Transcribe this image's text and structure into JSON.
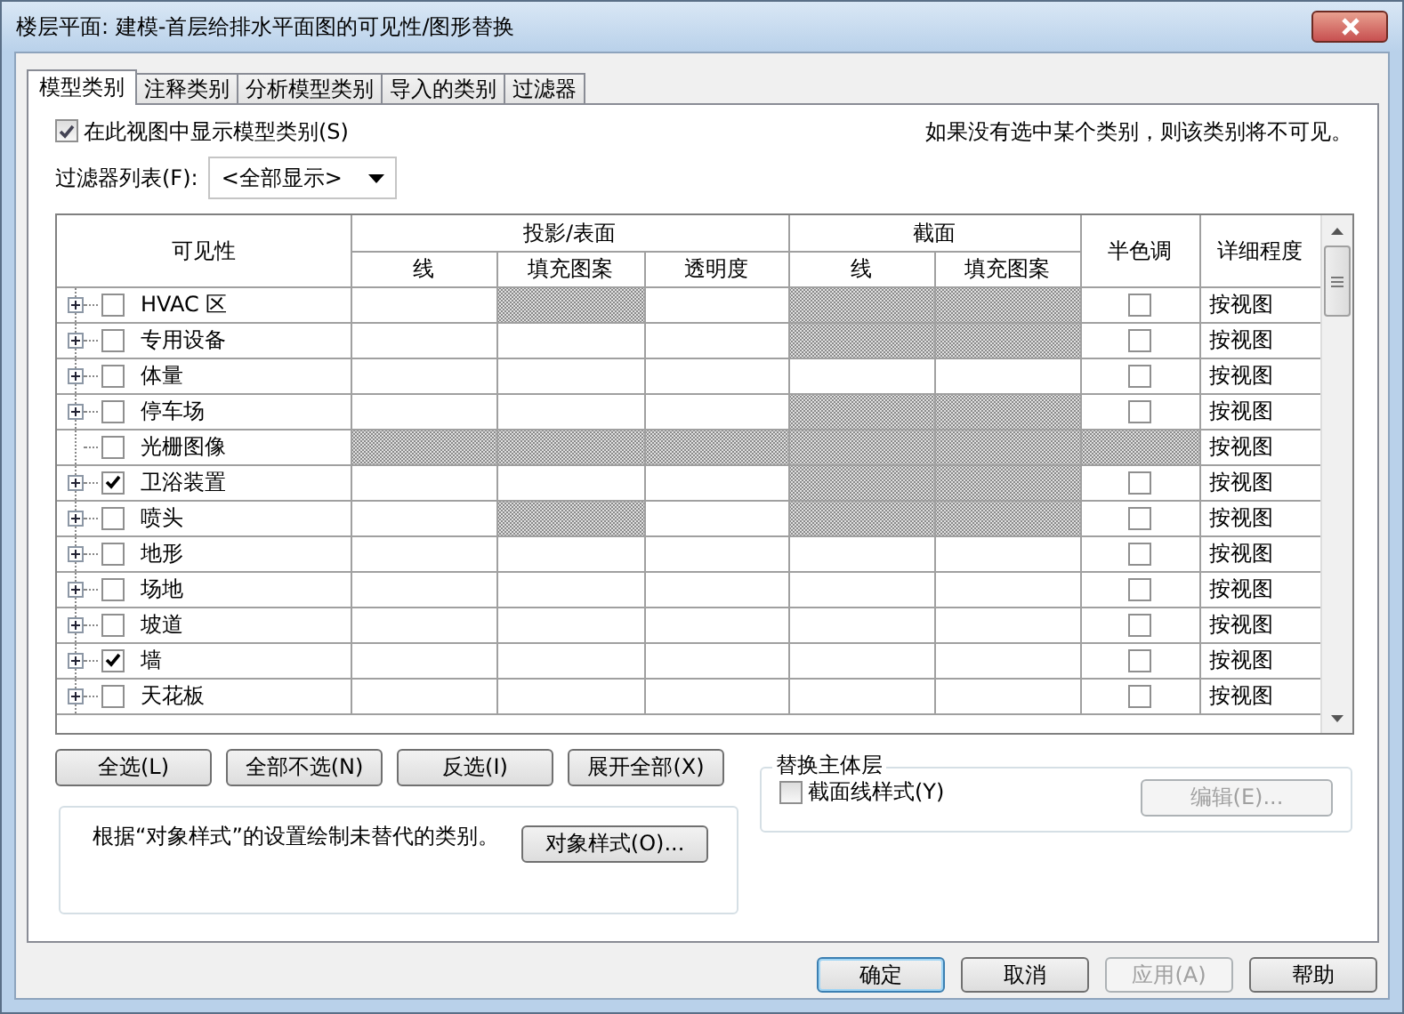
{
  "window": {
    "title": "楼层平面: 建模-首层给排水平面图的可见性/图形替换"
  },
  "tabs": [
    {
      "label": "模型类别",
      "selected": true
    },
    {
      "label": "注释类别",
      "selected": false
    },
    {
      "label": "分析模型类别",
      "selected": false
    },
    {
      "label": "导入的类别",
      "selected": false
    },
    {
      "label": "过滤器",
      "selected": false
    }
  ],
  "show_categories": {
    "label": "在此视图中显示模型类别(S)",
    "checked": true
  },
  "hint": "如果没有选中某个类别，则该类别将不可见。",
  "filter_list": {
    "label": "过滤器列表(F):",
    "value": "<全部显示>"
  },
  "table": {
    "columns": [
      {
        "label": "可见性"
      },
      {
        "label": "投影/表面",
        "children": [
          "线",
          "填充图案",
          "透明度"
        ]
      },
      {
        "label": "截面",
        "children": [
          "线",
          "填充图案"
        ]
      },
      {
        "label": "半色调"
      },
      {
        "label": "详细程度"
      }
    ],
    "rows": [
      {
        "name": "HVAC 区",
        "checked": false,
        "expandable": true,
        "overrides": [
          {
            "unavailable": false
          },
          {
            "unavailable": true
          },
          {
            "unavailable": false
          },
          {
            "unavailable": true
          },
          {
            "unavailable": true
          }
        ],
        "halftone": {
          "checked": false,
          "unavailable": false
        },
        "detail_level": "按视图"
      },
      {
        "name": "专用设备",
        "checked": false,
        "expandable": true,
        "overrides": [
          {
            "unavailable": false
          },
          {
            "unavailable": false
          },
          {
            "unavailable": false
          },
          {
            "unavailable": true
          },
          {
            "unavailable": true
          }
        ],
        "halftone": {
          "checked": false,
          "unavailable": false
        },
        "detail_level": "按视图"
      },
      {
        "name": "体量",
        "checked": false,
        "expandable": true,
        "overrides": [
          {
            "unavailable": false
          },
          {
            "unavailable": false
          },
          {
            "unavailable": false
          },
          {
            "unavailable": false
          },
          {
            "unavailable": false
          }
        ],
        "halftone": {
          "checked": false,
          "unavailable": false
        },
        "detail_level": "按视图"
      },
      {
        "name": "停车场",
        "checked": false,
        "expandable": true,
        "overrides": [
          {
            "unavailable": false
          },
          {
            "unavailable": false
          },
          {
            "unavailable": false
          },
          {
            "unavailable": true
          },
          {
            "unavailable": true
          }
        ],
        "halftone": {
          "checked": false,
          "unavailable": false
        },
        "detail_level": "按视图"
      },
      {
        "name": "光栅图像",
        "checked": false,
        "expandable": false,
        "overrides": [
          {
            "unavailable": true
          },
          {
            "unavailable": true
          },
          {
            "unavailable": true
          },
          {
            "unavailable": true
          },
          {
            "unavailable": true
          }
        ],
        "halftone": {
          "unavailable": true
        },
        "detail_level": "按视图"
      },
      {
        "name": "卫浴装置",
        "checked": true,
        "expandable": true,
        "overrides": [
          {
            "unavailable": false
          },
          {
            "unavailable": false
          },
          {
            "unavailable": false
          },
          {
            "unavailable": true
          },
          {
            "unavailable": true
          }
        ],
        "halftone": {
          "checked": false,
          "unavailable": false
        },
        "detail_level": "按视图"
      },
      {
        "name": "喷头",
        "checked": false,
        "expandable": true,
        "overrides": [
          {
            "unavailable": false
          },
          {
            "unavailable": true
          },
          {
            "unavailable": false
          },
          {
            "unavailable": true
          },
          {
            "unavailable": true
          }
        ],
        "halftone": {
          "checked": false,
          "unavailable": false
        },
        "detail_level": "按视图"
      },
      {
        "name": "地形",
        "checked": false,
        "expandable": true,
        "overrides": [
          {
            "unavailable": false
          },
          {
            "unavailable": false
          },
          {
            "unavailable": false
          },
          {
            "unavailable": false
          },
          {
            "unavailable": false
          }
        ],
        "halftone": {
          "checked": false,
          "unavailable": false
        },
        "detail_level": "按视图"
      },
      {
        "name": "场地",
        "checked": false,
        "expandable": true,
        "overrides": [
          {
            "unavailable": false
          },
          {
            "unavailable": false
          },
          {
            "unavailable": false
          },
          {
            "unavailable": false
          },
          {
            "unavailable": false
          }
        ],
        "halftone": {
          "checked": false,
          "unavailable": false
        },
        "detail_level": "按视图"
      },
      {
        "name": "坡道",
        "checked": false,
        "expandable": true,
        "overrides": [
          {
            "unavailable": false
          },
          {
            "unavailable": false
          },
          {
            "unavailable": false
          },
          {
            "unavailable": false
          },
          {
            "unavailable": false
          }
        ],
        "halftone": {
          "checked": false,
          "unavailable": false
        },
        "detail_level": "按视图"
      },
      {
        "name": "墙",
        "checked": true,
        "expandable": true,
        "overrides": [
          {
            "unavailable": false
          },
          {
            "unavailable": false
          },
          {
            "unavailable": false
          },
          {
            "unavailable": false
          },
          {
            "unavailable": false
          }
        ],
        "halftone": {
          "checked": false,
          "unavailable": false
        },
        "detail_level": "按视图"
      },
      {
        "name": "天花板",
        "checked": false,
        "expandable": true,
        "overrides": [
          {
            "unavailable": false
          },
          {
            "unavailable": false
          },
          {
            "unavailable": false
          },
          {
            "unavailable": false
          },
          {
            "unavailable": false
          }
        ],
        "halftone": {
          "checked": false,
          "unavailable": false
        },
        "detail_level": "按视图"
      }
    ]
  },
  "selection_buttons": [
    "全选(L)",
    "全部不选(N)",
    "反选(I)",
    "展开全部(X)"
  ],
  "object_styles": {
    "text": "根据“对象样式”的设置绘制未替代的类别。",
    "button": "对象样式(O)..."
  },
  "host_layers": {
    "title": "替换主体层",
    "checkbox": {
      "label": "截面线样式(Y)",
      "checked": false
    },
    "edit_button": {
      "label": "编辑(E)...",
      "disabled": true
    }
  },
  "dialog_buttons": [
    {
      "label": "确定",
      "default": true,
      "disabled": false
    },
    {
      "label": "取消",
      "default": false,
      "disabled": false
    },
    {
      "label": "应用(A)",
      "default": false,
      "disabled": true
    },
    {
      "label": "帮助",
      "default": false,
      "disabled": false
    }
  ]
}
